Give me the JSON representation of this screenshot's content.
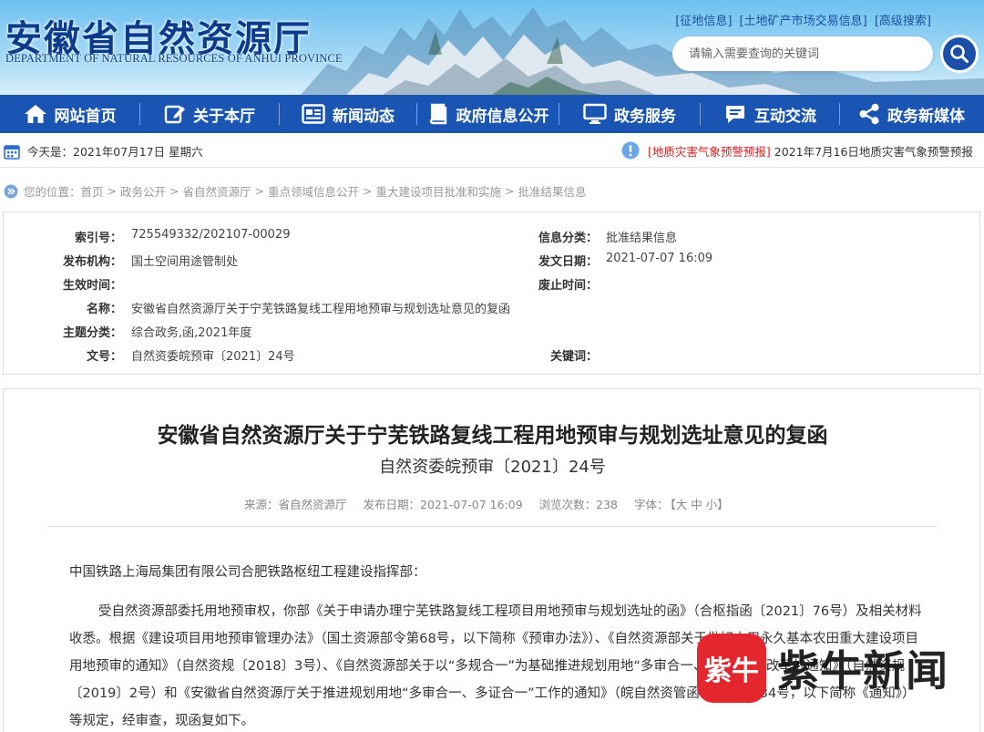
{
  "header": {
    "title_cn": "安徽省自然资源厅",
    "title_en": "DEPARTMENT OF NATURAL RESOURCES OF ANHUI PROVINCE",
    "top_links": [
      "[征地信息]",
      "[土地矿产市场交易信息]",
      "[高级搜索]"
    ],
    "search_placeholder": "请输入需要查询的关键词"
  },
  "nav": {
    "items": [
      {
        "label": "网站首页",
        "icon": "home-icon"
      },
      {
        "label": "关于本厅",
        "icon": "edit-icon"
      },
      {
        "label": "新闻动态",
        "icon": "news-icon"
      },
      {
        "label": "政府信息公开",
        "icon": "book-icon"
      },
      {
        "label": "政务服务",
        "icon": "monitor-icon"
      },
      {
        "label": "互动交流",
        "icon": "chat-icon"
      },
      {
        "label": "政务新媒体",
        "icon": "share-icon"
      }
    ]
  },
  "infobar": {
    "today": "今天是：2021年07月17日 星期六",
    "alert_tag": "[地质灾害气象预警预报]",
    "alert_text": "2021年7月16日地质灾害气象预警预报"
  },
  "breadcrumb": {
    "prefix": "您的位置：",
    "items": [
      "首页",
      "政务公开",
      "省自然资源厅",
      "重点领域信息公开",
      "重大建设项目批准和实施",
      "批准结果信息"
    ]
  },
  "meta": {
    "index_label": "索引号：",
    "index_value": "725549332/202107-00029",
    "category_label": "信息分类：",
    "category_value": "批准结果信息",
    "org_label": "发布机构：",
    "org_value": "国土空间用途管制处",
    "date_label": "发文日期：",
    "date_value": "2021-07-07 16:09",
    "effective_label": "生效时间：",
    "effective_value": "",
    "abolish_label": "废止时间：",
    "abolish_value": "",
    "name_label": "名称：",
    "name_value": "安徽省自然资源厅关于宁芜铁路复线工程用地预审与规划选址意见的复函",
    "topic_label": "主题分类：",
    "topic_value": "综合政务,函,2021年度",
    "docno_label": "文号：",
    "docno_value": "自然资委皖预审〔2021〕24号",
    "keyword_label": "关键词：",
    "keyword_value": ""
  },
  "article": {
    "title": "安徽省自然资源厅关于宁芜铁路复线工程用地预审与规划选址意见的复函",
    "subtitle": "自然资委皖预审〔2021〕24号",
    "source": "来源：省自然资源厅",
    "publish_date": "发布日期：2021-07-07 16:09",
    "views": "浏览次数：238",
    "font_label": "字体：",
    "font_sizes": "【大 中 小】",
    "para1": "中国铁路上海局集团有限公司合肥铁路枢纽工程建设指挥部：",
    "para2": "受自然资源部委托用地预审权，你部《关于申请办理宁芜铁路复线工程项目用地预审与规划选址的函》（合枢指函〔2021〕76号）及相关材料收悉。根据《建设项目用地预审管理办法》（国土资源部令第68号，以下简称《预审办法》）、《自然资源部关于做好占用永久基本农田重大建设项目用地预审的通知》（自然资规〔2018〕3号）、《自然资源部关于以“多规合一”为基础推进规划用地“多审合一、多证合一”改革的通知》（自然资规〔2019〕2号）和《安徽省自然资源厅关于推进规划用地“多审合一、多证合一”工作的通知》（皖自然资管函〔2020〕34号，以下简称《通知》）等规定，经审查，现函复如下。"
  },
  "watermark": {
    "logo_text": "紫牛",
    "text": "紫牛新闻"
  },
  "colors": {
    "nav_bg": "#1a55b4",
    "brand_blue": "#0b3c8c",
    "alert_red": "#d21f1f",
    "watermark_red": "#e4262e"
  }
}
